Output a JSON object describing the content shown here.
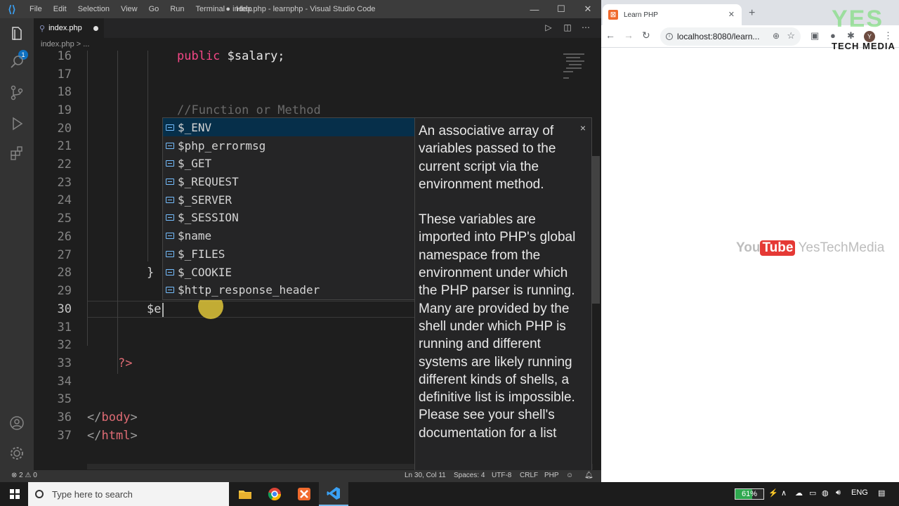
{
  "vscode": {
    "menu": [
      "File",
      "Edit",
      "Selection",
      "View",
      "Go",
      "Run",
      "Terminal",
      "Help"
    ],
    "title": "● index.php - learnphp - Visual Studio Code",
    "explorer_badge": "1",
    "tab_label": "index.php",
    "breadcrumb": "index.php > ...",
    "line_numbers": [
      "16",
      "17",
      "18",
      "19",
      "20",
      "21",
      "22",
      "23",
      "24",
      "25",
      "26",
      "27",
      "28",
      "29",
      "30",
      "31",
      "32",
      "33",
      "34",
      "35",
      "36",
      "37"
    ],
    "current_line": "30",
    "code": {
      "line16_kw": "public",
      "line16_var": " $salary;",
      "line19_comment": "//Function or Method",
      "line28": "}",
      "line30": "$e",
      "line33": "?>",
      "line36_open": "</",
      "line36_tag": "body",
      "line36_close": ">",
      "line37_open": "</",
      "line37_tag": "html",
      "line37_close": ">"
    },
    "suggestions": [
      "$_ENV",
      "$php_errormsg",
      "$_GET",
      "$_REQUEST",
      "$_SERVER",
      "$_SESSION",
      "$name",
      "$_FILES",
      "$_COOKIE",
      "$http_response_header"
    ],
    "suggestion_detail": {
      "para1": "An associative array of variables passed to the current script via the environment method.",
      "para2": "These variables are imported into PHP's global namespace from the environment under which the PHP parser is running. Many are provided by the shell under which PHP is running and different systems are likely running different kinds of shells, a definitive list is impossible. Please see your shell's documentation for a list",
      "close_glyph": "×"
    },
    "status": {
      "errors": "2",
      "warnings": "0",
      "position": "Ln 30, Col 11",
      "spaces": "Spaces: 4",
      "encoding": "UTF-8",
      "eol": "CRLF",
      "language": "PHP"
    }
  },
  "chrome": {
    "tab_title": "Learn PHP",
    "url": "localhost:8080/learn...",
    "avatar_letter": "Y",
    "watermark_top": "YES",
    "watermark_bottom": "TECH MEDIA",
    "yt_you": "You",
    "yt_tube": "Tube",
    "yt_channel": "YesTechMedia"
  },
  "taskbar": {
    "search_placeholder": "Type here to search",
    "battery": 61,
    "battery_label": "61%",
    "language": "ENG"
  },
  "colors": {
    "accent": "#0e70c0",
    "keyword": "#f44786",
    "tag": "#e06c75",
    "battery": "#2fa84f"
  },
  "icons": [
    "files-icon",
    "search-icon",
    "source-control-icon",
    "run-debug-icon",
    "extensions-icon",
    "account-icon",
    "settings-gear-icon",
    "run-icon",
    "split-editor-icon",
    "more-icon"
  ]
}
